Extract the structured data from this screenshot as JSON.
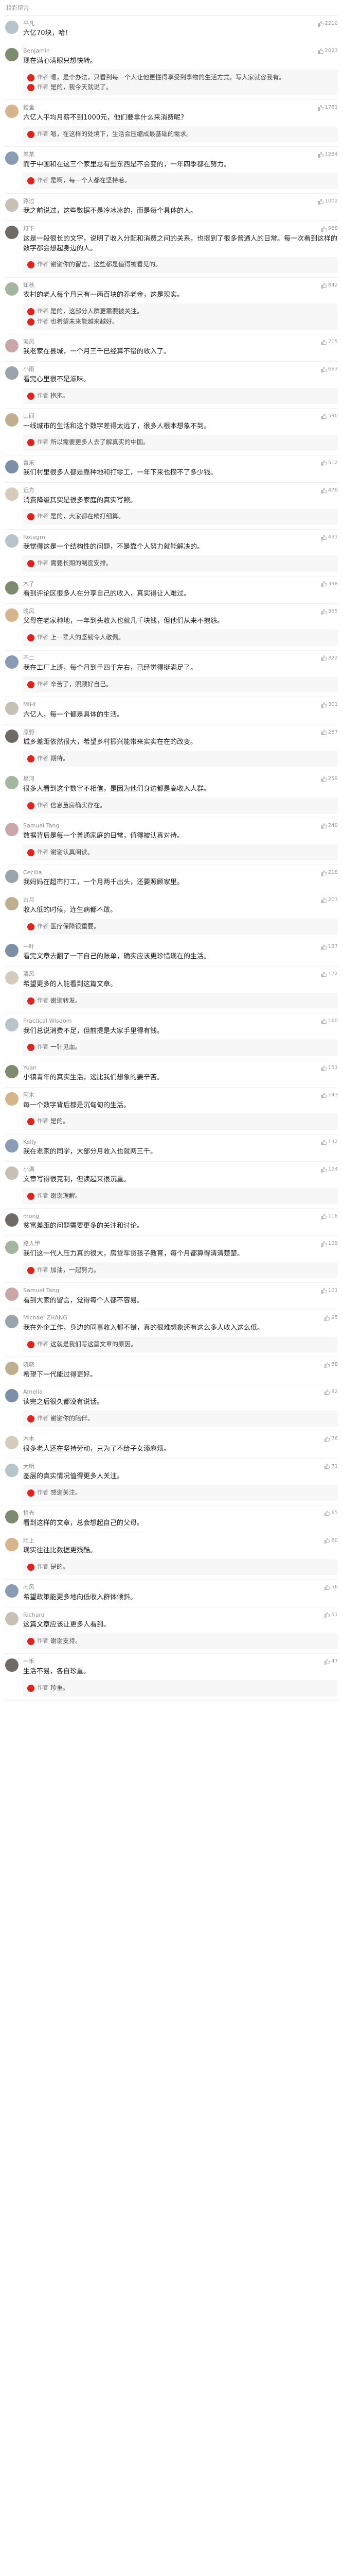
{
  "section_label": "精彩留言",
  "colors": {
    "avatars": [
      "#b7c4c9",
      "#7d8b6f",
      "#d6b48c",
      "#8a9bb4",
      "#c6c0b5",
      "#6f6a63",
      "#a4b6a0",
      "#caa7a7",
      "#9aa4ad",
      "#bfae8f",
      "#7b8fa6",
      "#d4cbbc"
    ],
    "badge": "#e0241c",
    "link": "#4a78b0"
  },
  "icons": {
    "like": "thumb-up-icon",
    "avatar": "user-avatar-icon",
    "badge": "author-badge-icon"
  },
  "comments": [
    {
      "user": "平凡",
      "time": "",
      "likes": "2210",
      "text": "六亿70块，哈！",
      "replies": []
    },
    {
      "user": "Benjamin",
      "time": "",
      "likes": "2023",
      "text": "现在满心满眼只想快转。",
      "replies": [
        {
          "user": "作者",
          "text": "嗯，是个办法，只看到每一个人让他更懂得享受到事物的生活方式，写人家就容我有。"
        },
        {
          "user": "作者",
          "text": "是的，我今天就说了。"
        }
      ],
      "more": ""
    },
    {
      "user": "鳕鱼",
      "time": "",
      "likes": "1761",
      "text": "六亿人平均月薪不到1000元，他们要拿什么来消费呢？",
      "replies": [
        {
          "user": "作者",
          "text": "嗯，在这样的处境下，生活会压缩成最基础的需求。"
        }
      ],
      "more": ""
    },
    {
      "user": "某某",
      "time": "",
      "likes": "1284",
      "text": "而于中国和在这三个家里总有些东西是不会变的，一年四季都在努力。",
      "replies": [
        {
          "user": "作者",
          "text": "是啊，每一个人都在坚持着。"
        }
      ],
      "more": ""
    },
    {
      "user": "路过",
      "time": "",
      "likes": "1002",
      "text": "我之前说过，这些数据不是冷冰冰的，而是每个具体的人。",
      "replies": [],
      "more": ""
    },
    {
      "user": "灯下",
      "time": "",
      "likes": "968",
      "text": "这是一段很长的文字，说明了收入分配和消费之间的关系，也提到了很多普通人的日常。每一次看到这样的数字都会想起身边的人。",
      "replies": [
        {
          "user": "作者",
          "text": "谢谢你的留言，这些都是值得被看见的。"
        }
      ],
      "more": ""
    },
    {
      "user": "知秋",
      "time": "",
      "likes": "842",
      "text": "农村的老人每个月只有一两百块的养老金，这是现实。",
      "replies": [
        {
          "user": "作者",
          "text": "是的，这部分人群更需要被关注。"
        },
        {
          "user": "作者",
          "text": "也希望未来能越来越好。"
        }
      ],
      "more": ""
    },
    {
      "user": "海风",
      "time": "",
      "likes": "715",
      "text": "我老家在县城，一个月三千已经算不错的收入了。",
      "replies": [],
      "more": ""
    },
    {
      "user": "小雨",
      "time": "",
      "likes": "663",
      "text": "看完心里很不是滋味。",
      "replies": [
        {
          "user": "作者",
          "text": "抱抱。"
        }
      ],
      "more": ""
    },
    {
      "user": "山间",
      "time": "",
      "likes": "590",
      "text": "一线城市的生活和这个数字差得太远了，很多人根本想象不到。",
      "replies": [
        {
          "user": "作者",
          "text": "所以需要更多人去了解真实的中国。"
        }
      ],
      "more": ""
    },
    {
      "user": "青禾",
      "time": "",
      "likes": "512",
      "text": "我们村里很多人都是靠种地和打零工，一年下来也攒不了多少钱。",
      "replies": [],
      "more": ""
    },
    {
      "user": "远方",
      "time": "",
      "likes": "476",
      "text": "消费降级其实是很多家庭的真实写照。",
      "replies": [
        {
          "user": "作者",
          "text": "是的，大家都在精打细算。"
        }
      ],
      "more": ""
    },
    {
      "user": "Rotegm",
      "time": "",
      "likes": "431",
      "text": "我觉得这是一个结构性的问题，不是靠个人努力就能解决的。",
      "replies": [
        {
          "user": "作者",
          "text": "需要长期的制度安排。"
        }
      ],
      "more": ""
    },
    {
      "user": "木子",
      "time": "",
      "likes": "398",
      "text": "看到评论区很多人在分享自己的收入，真实得让人难过。",
      "replies": [],
      "more": ""
    },
    {
      "user": "晚风",
      "time": "",
      "likes": "365",
      "text": "父母在老家种地，一年到头收入也就几千块钱，但他们从来不抱怨。",
      "replies": [
        {
          "user": "作者",
          "text": "上一辈人的坚韧令人敬佩。"
        }
      ],
      "more": ""
    },
    {
      "user": "不二",
      "time": "",
      "likes": "322",
      "text": "我在工厂上班，每个月到手四千左右，已经觉得挺满足了。",
      "replies": [
        {
          "user": "作者",
          "text": "辛苦了，照顾好自己。"
        }
      ],
      "more": ""
    },
    {
      "user": "MIHI",
      "time": "",
      "likes": "301",
      "text": "六亿人，每一个都是具体的生活。",
      "replies": [],
      "more": ""
    },
    {
      "user": "原野",
      "time": "",
      "likes": "287",
      "text": "城乡差距依然很大，希望乡村振兴能带来实实在在的改变。",
      "replies": [
        {
          "user": "作者",
          "text": "期待。"
        }
      ],
      "more": ""
    },
    {
      "user": "星河",
      "time": "",
      "likes": "259",
      "text": "很多人看到这个数字不相信，是因为他们身边都是高收入人群。",
      "replies": [
        {
          "user": "作者",
          "text": "信息茧房确实存在。"
        }
      ],
      "more": ""
    },
    {
      "user": "Samuel Tang",
      "time": "",
      "likes": "240",
      "text": "数据背后是每一个普通家庭的日常，值得被认真对待。",
      "replies": [
        {
          "user": "作者",
          "text": "谢谢认真阅读。"
        }
      ],
      "more": ""
    },
    {
      "user": "Cecilia",
      "time": "",
      "likes": "218",
      "text": "我妈妈在超市打工，一个月两千出头，还要照顾家里。",
      "replies": [],
      "more": ""
    },
    {
      "user": "古月",
      "time": "",
      "likes": "203",
      "text": "收入低的时候，连生病都不敢。",
      "replies": [
        {
          "user": "作者",
          "text": "医疗保障很重要。"
        }
      ],
      "more": ""
    },
    {
      "user": "一叶",
      "time": "",
      "likes": "187",
      "text": "看完文章去翻了一下自己的账单，确实应该更珍惜现在的生活。",
      "replies": [],
      "more": ""
    },
    {
      "user": "清风",
      "time": "",
      "likes": "172",
      "text": "希望更多的人能看到这篇文章。",
      "replies": [
        {
          "user": "作者",
          "text": "谢谢转发。"
        }
      ],
      "more": ""
    },
    {
      "user": "Practical Wisdom",
      "time": "",
      "likes": "160",
      "text": "我们总说消费不足，但前提是大家手里得有钱。",
      "replies": [
        {
          "user": "作者",
          "text": "一针见血。"
        }
      ],
      "more": ""
    },
    {
      "user": "Yuan",
      "time": "",
      "likes": "151",
      "text": "小镇青年的真实生活，远比我们想象的要辛苦。",
      "replies": [],
      "more": ""
    },
    {
      "user": "阿木",
      "time": "",
      "likes": "143",
      "text": "每一个数字背后都是沉甸甸的生活。",
      "replies": [
        {
          "user": "作者",
          "text": "是的。"
        }
      ],
      "more": ""
    },
    {
      "user": "Kelly",
      "time": "",
      "likes": "132",
      "text": "我在老家的同学，大部分月收入也就两三千。",
      "replies": [],
      "more": ""
    },
    {
      "user": "小满",
      "time": "",
      "likes": "124",
      "text": "文章写得很克制，但读起来很沉重。",
      "replies": [
        {
          "user": "作者",
          "text": "谢谢理解。"
        }
      ],
      "more": ""
    },
    {
      "user": "mong",
      "time": "",
      "likes": "118",
      "text": "贫富差距的问题需要更多的关注和讨论。",
      "replies": [],
      "more": ""
    },
    {
      "user": "路人甲",
      "time": "",
      "likes": "109",
      "text": "我们这一代人压力真的很大，房贷车贷孩子教育，每个月都算得清清楚楚。",
      "replies": [
        {
          "user": "作者",
          "text": "加油，一起努力。"
        }
      ],
      "more": ""
    },
    {
      "user": "Samuel Tang",
      "time": "",
      "likes": "101",
      "text": "看到大家的留言，觉得每个人都不容易。",
      "replies": [],
      "more": ""
    },
    {
      "user": "Michael ZHANG",
      "time": "",
      "likes": "95",
      "text": "我在外企工作，身边的同事收入都不错，真的很难想象还有这么多人收入这么低。",
      "replies": [
        {
          "user": "作者",
          "text": "这就是我们写这篇文章的原因。"
        }
      ],
      "more": ""
    },
    {
      "user": "晓晓",
      "time": "",
      "likes": "88",
      "text": "希望下一代能过得更好。",
      "replies": [],
      "more": ""
    },
    {
      "user": "Amelia",
      "time": "",
      "likes": "82",
      "text": "读完之后很久都没有说话。",
      "replies": [
        {
          "user": "作者",
          "text": "谢谢你的陪伴。"
        }
      ],
      "more": ""
    },
    {
      "user": "木木",
      "time": "",
      "likes": "76",
      "text": "很多老人还在坚持劳动，只为了不给子女添麻烦。",
      "replies": [],
      "more": ""
    },
    {
      "user": "大明",
      "time": "",
      "likes": "71",
      "text": "基层的真实情况值得更多人关注。",
      "replies": [
        {
          "user": "作者",
          "text": "感谢关注。"
        }
      ],
      "more": ""
    },
    {
      "user": "拾光",
      "time": "",
      "likes": "65",
      "text": "看到这样的文章，总会想起自己的父母。",
      "replies": [],
      "more": ""
    },
    {
      "user": "陌上",
      "time": "",
      "likes": "60",
      "text": "现实往往比数据更残酷。",
      "replies": [
        {
          "user": "作者",
          "text": "是的。"
        }
      ],
      "more": ""
    },
    {
      "user": "南风",
      "time": "",
      "likes": "56",
      "text": "希望政策能更多地向低收入群体倾斜。",
      "replies": [],
      "more": ""
    },
    {
      "user": "Richard",
      "time": "",
      "likes": "51",
      "text": "这篇文章应该让更多人看到。",
      "replies": [
        {
          "user": "作者",
          "text": "谢谢支持。"
        }
      ],
      "more": ""
    },
    {
      "user": "一禾",
      "time": "",
      "likes": "47",
      "text": "生活不易，各自珍重。",
      "replies": [
        {
          "user": "作者",
          "text": "珍重。"
        }
      ],
      "more": ""
    }
  ]
}
